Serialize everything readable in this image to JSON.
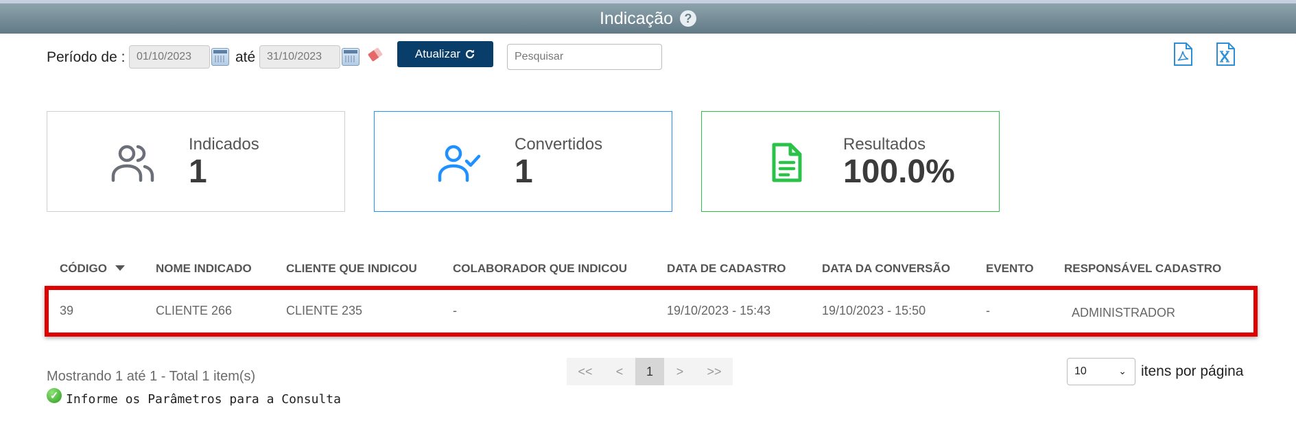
{
  "header": {
    "title": "Indicação",
    "help_icon": "question-circle-icon"
  },
  "filters": {
    "period_label": "Período de :",
    "date_from": "01/10/2023",
    "until_label": "até",
    "date_to": "31/10/2023",
    "update_label": "Atualizar",
    "search_placeholder": "Pesquisar",
    "export_icons": [
      "pdf-icon",
      "excel-icon"
    ]
  },
  "cards": [
    {
      "label": "Indicados",
      "value": "1",
      "icon": "users-icon",
      "color": "#6b6f78"
    },
    {
      "label": "Convertidos",
      "value": "1",
      "icon": "user-check-icon",
      "color": "#1e90ff"
    },
    {
      "label": "Resultados",
      "value": "100.0%",
      "icon": "file-text-icon",
      "color": "#2bc24a"
    }
  ],
  "table": {
    "columns": [
      "CÓDIGO",
      "NOME INDICADO",
      "CLIENTE QUE INDICOU",
      "COLABORADOR QUE INDICOU",
      "DATA DE CADASTRO",
      "DATA DA CONVERSÃO",
      "EVENTO",
      "RESPONSÁVEL CADASTRO"
    ],
    "sort_column": "CÓDIGO",
    "rows": [
      [
        "39",
        "CLIENTE 266",
        "CLIENTE 235",
        "-",
        "19/10/2023 - 15:43",
        "19/10/2023 - 15:50",
        "-",
        "ADMINISTRADOR"
      ]
    ],
    "highlight_color": "#e00000"
  },
  "footer": {
    "showing": "Mostrando 1 até 1 - Total 1 item(s)",
    "info_message": "Informe os Parâmetros para a Consulta",
    "pagination": [
      "<<",
      "<",
      "1",
      ">",
      ">>"
    ],
    "current_page": "1",
    "per_page_value": "10",
    "per_page_label": "itens por página"
  },
  "colors": {
    "header": "#6f8793",
    "primary_button": "#083e69"
  }
}
